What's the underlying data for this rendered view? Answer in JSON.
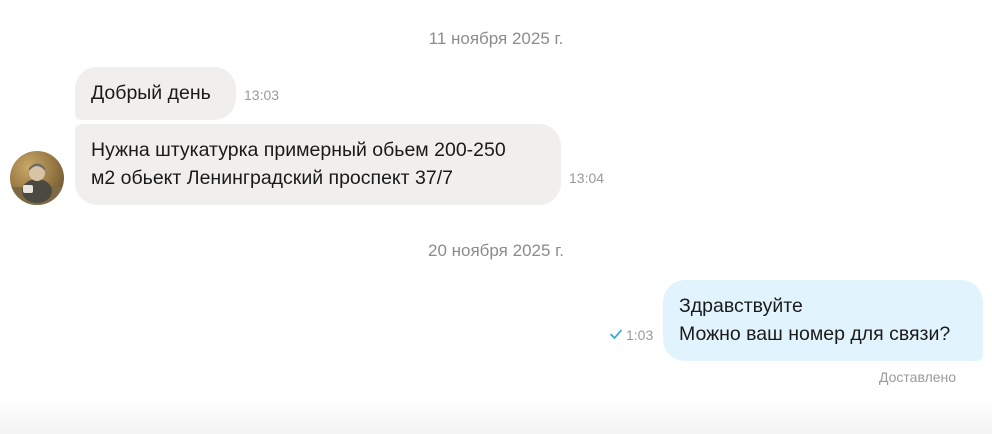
{
  "dates": {
    "first": "11 ноября 2025 г.",
    "second": "20 ноября 2025 г."
  },
  "messages": [
    {
      "direction": "incoming",
      "text": "Добрый день",
      "time": "13:03"
    },
    {
      "direction": "incoming",
      "line1": "Нужна штукатурка примерный обьем 200-250",
      "line2": "м2 обьект Ленинградский проспект 37/7",
      "time": "13:04"
    },
    {
      "direction": "outgoing",
      "line1": "Здравствуйте",
      "line2": "Можно ваш номер для связи?",
      "time": "1:03",
      "status": "Доставлено"
    }
  ],
  "icons": {
    "avatar": "user-avatar-photo",
    "check": "check-icon"
  },
  "colors": {
    "incoming_bubble": "#f1efed",
    "outgoing_bubble": "#e1f4fd",
    "check": "#2aa3d6"
  }
}
